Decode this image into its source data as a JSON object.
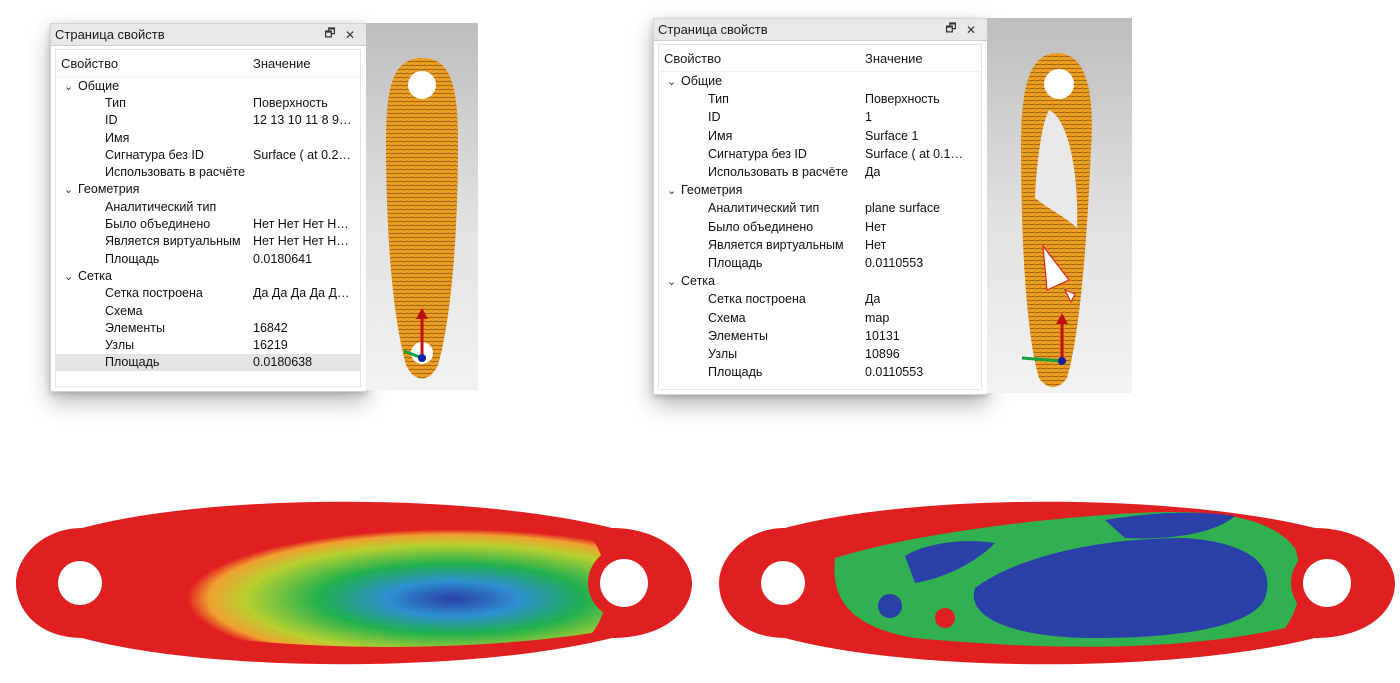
{
  "panels": [
    {
      "title": "Страница свойств",
      "header": {
        "property": "Свойство",
        "value": "Значение"
      },
      "groups": [
        {
          "name": "Общие",
          "items": [
            {
              "label": "Тип",
              "value": "Поверхность"
            },
            {
              "label": "ID",
              "value": "12 13 10 11 8 9…"
            },
            {
              "label": "Имя",
              "value": ""
            },
            {
              "label": "Сигнатура без ID",
              "value": "Surface ( at 0.2…"
            },
            {
              "label": "Использовать в расчёте",
              "value": ""
            }
          ]
        },
        {
          "name": "Геометрия",
          "items": [
            {
              "label": "Аналитический тип",
              "value": ""
            },
            {
              "label": "Было объединено",
              "value": "Нет Нет Нет Н…"
            },
            {
              "label": "Является виртуальным",
              "value": "Нет Нет Нет Н…"
            },
            {
              "label": "Площадь",
              "value": "0.0180641"
            }
          ]
        },
        {
          "name": "Сетка",
          "items": [
            {
              "label": "Сетка построена",
              "value": "Да Да Да Да Д…"
            },
            {
              "label": "Схема",
              "value": ""
            },
            {
              "label": "Элементы",
              "value": "16842"
            },
            {
              "label": "Узлы",
              "value": "16219"
            },
            {
              "label": "Площадь",
              "value": "0.0180638",
              "selected": true
            }
          ]
        }
      ]
    },
    {
      "title": "Страница свойств",
      "header": {
        "property": "Свойство",
        "value": "Значение"
      },
      "groups": [
        {
          "name": "Общие",
          "items": [
            {
              "label": "Тип",
              "value": "Поверхность"
            },
            {
              "label": "ID",
              "value": "1"
            },
            {
              "label": "Имя",
              "value": "Surface 1"
            },
            {
              "label": "Сигнатура без ID",
              "value": "Surface ( at 0.1…"
            },
            {
              "label": "Использовать в расчёте",
              "value": "Да"
            }
          ]
        },
        {
          "name": "Геометрия",
          "items": [
            {
              "label": "Аналитический тип",
              "value": "plane surface"
            },
            {
              "label": "Было объединено",
              "value": "Нет"
            },
            {
              "label": "Является виртуальным",
              "value": "Нет"
            },
            {
              "label": "Площадь",
              "value": "0.0110553"
            }
          ]
        },
        {
          "name": "Сетка",
          "items": [
            {
              "label": "Сетка построена",
              "value": "Да"
            },
            {
              "label": "Схема",
              "value": "map"
            },
            {
              "label": "Элементы",
              "value": "10131"
            },
            {
              "label": "Узлы",
              "value": "10896"
            },
            {
              "label": "Площадь",
              "value": "0.0110553"
            }
          ]
        }
      ]
    }
  ],
  "icons": {
    "restore": "restore-icon",
    "close": "close-icon",
    "expand": "chevron-down-icon"
  },
  "glyphs": {
    "restore": "🗗",
    "close": "✕",
    "chevron": "⌄"
  },
  "colors": {
    "mesh": "#f0a020",
    "stress_high": "#e02020",
    "stress_mid": "#20b050",
    "stress_low": "#2040a0",
    "axis_x": "#10a040",
    "axis_y": "#c01010",
    "axis_z": "#1020a0"
  }
}
